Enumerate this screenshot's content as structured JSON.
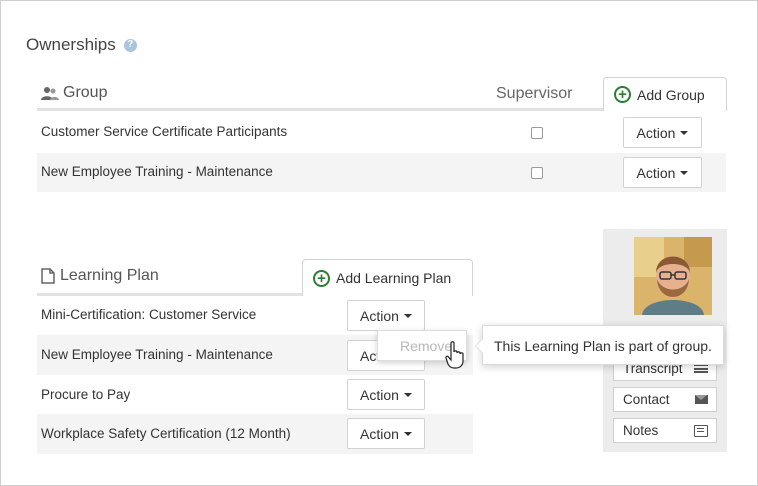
{
  "ownerships": {
    "title": "Ownerships",
    "help_icon": "?"
  },
  "group": {
    "title": "Group",
    "supervisor_label": "Supervisor",
    "add_label": "Add Group",
    "rows": [
      {
        "name": "Customer Service Certificate Participants",
        "supervisor": false,
        "action": "Action"
      },
      {
        "name": "New Employee Training - Maintenance",
        "supervisor": false,
        "action": "Action"
      }
    ]
  },
  "learning_plan": {
    "title": "Learning Plan",
    "add_label": "Add Learning Plan",
    "rows": [
      {
        "name": "Mini-Certification: Customer Service",
        "action": "Action"
      },
      {
        "name": "New Employee Training - Maintenance",
        "action": "Act"
      },
      {
        "name": "Procure to Pay",
        "action": "Action"
      },
      {
        "name": "Workplace Safety Certification (12 Month)",
        "action": "Action"
      }
    ],
    "dropdown": {
      "remove_label": "Remove"
    },
    "tooltip": "This Learning Plan is part of group."
  },
  "profile_panel": {
    "buttons": [
      {
        "label": "Transcript",
        "icon": "list-icon"
      },
      {
        "label": "Contact",
        "icon": "mail-icon"
      },
      {
        "label": "Notes",
        "icon": "notes-icon"
      }
    ]
  },
  "colors": {
    "accent_green": "#2e7d32",
    "row_alt": "#f4f4f4",
    "panel_bg": "#ececec"
  }
}
